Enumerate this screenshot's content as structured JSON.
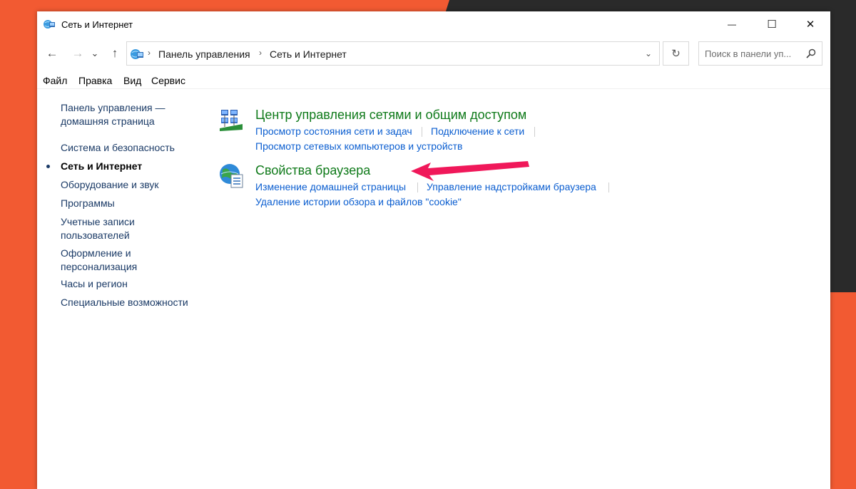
{
  "window": {
    "title": "Сеть и Интернет",
    "minimize_glyph": "—",
    "maximize_glyph": "☐",
    "close_glyph": "✕"
  },
  "nav": {
    "back_glyph": "←",
    "forward_glyph": "→",
    "recent_glyph": "⌄",
    "up_glyph": "↑",
    "refresh_glyph": "↻",
    "dropdown_glyph": "⌄"
  },
  "address": {
    "crumbs": [
      "Панель управления",
      "Сеть и Интернет"
    ],
    "separator": "›"
  },
  "search": {
    "placeholder": "Поиск в панели уп..."
  },
  "menu": {
    "items": [
      "Файл",
      "Правка",
      "Вид",
      "Сервис"
    ]
  },
  "sidebar": {
    "items": [
      {
        "label": "Панель управления — домашняя страница"
      },
      {
        "label": "Система и безопасность"
      },
      {
        "label": "Сеть и Интернет"
      },
      {
        "label": "Оборудование и звук"
      },
      {
        "label": "Программы"
      },
      {
        "label": "Учетные записи пользователей"
      },
      {
        "label": "Оформление и персонализация"
      },
      {
        "label": "Часы и регион"
      },
      {
        "label": "Специальные возможности"
      }
    ]
  },
  "sections": [
    {
      "title": "Центр управления сетями и общим доступом",
      "icon": "network-center-icon",
      "tasks": [
        "Просмотр состояния сети и задач",
        "Подключение к сети",
        "Просмотр сетевых компьютеров и устройств"
      ]
    },
    {
      "title": "Свойства браузера",
      "icon": "internet-options-icon",
      "tasks": [
        "Изменение домашней страницы",
        "Управление надстройками браузера",
        "Удаление истории обзора и файлов \"cookie\""
      ]
    }
  ],
  "colors": {
    "background": "#f25a32",
    "section_title": "#0f7a1a",
    "task_link": "#0b5ed0",
    "annotation_arrow": "#f0185a"
  }
}
